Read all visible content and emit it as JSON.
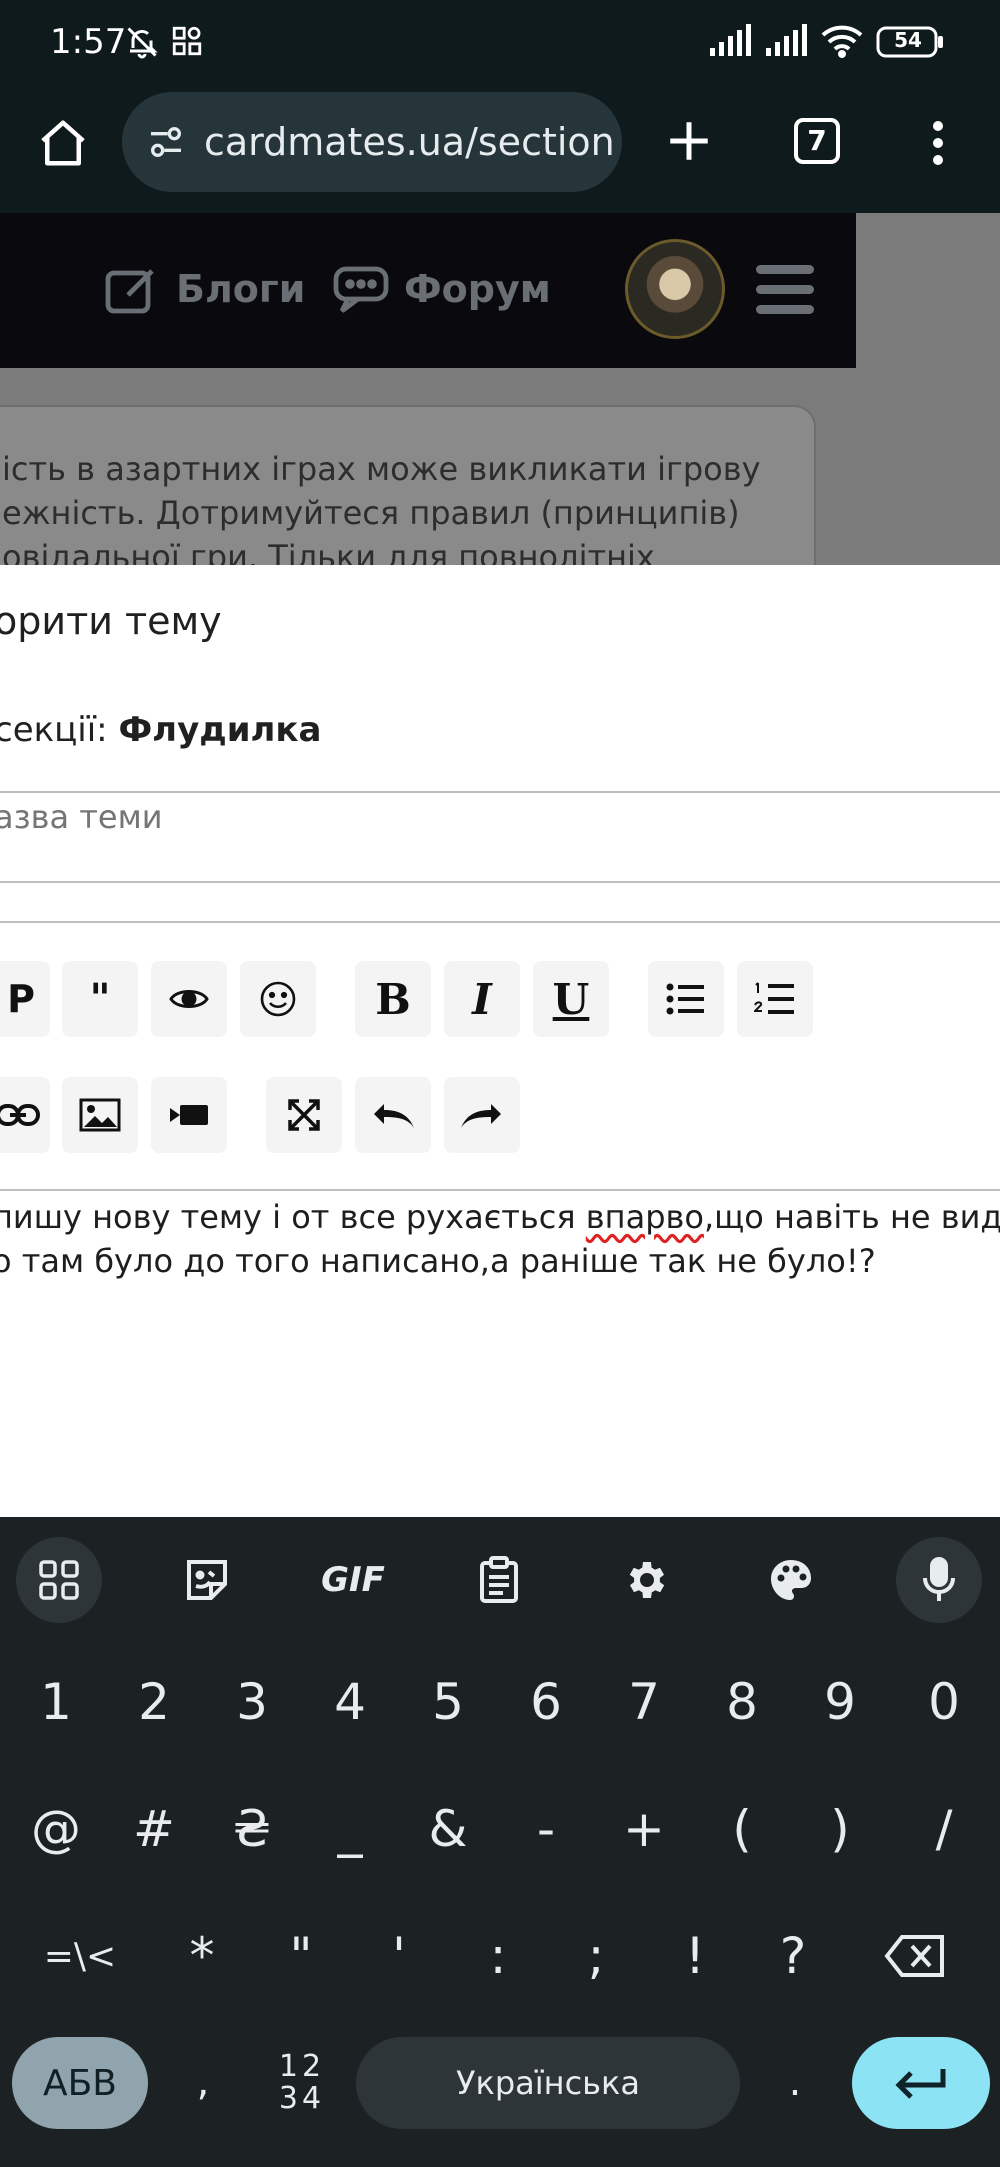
{
  "status_bar": {
    "time": "1:57",
    "battery": "54"
  },
  "browser": {
    "url": "cardmates.ua/section",
    "tab_count": "7"
  },
  "site_nav": {
    "blogs": "Блоги",
    "forum": "Форум"
  },
  "warning": {
    "text": "ість в азартних іграх може викликати ігрову ежність. Дотримуйтеся правил (принципів) овідальної гри. Тільки для повнолітніх"
  },
  "modal": {
    "title": "орити тему",
    "section_prefix": "секції: ",
    "section_name": "Флудилка",
    "topic_placeholder": "азва теми",
    "toolbar_row1": [
      "P",
      "\"",
      "eye",
      "smile",
      "B",
      "I",
      "U",
      "bullet-list",
      "numbered-list"
    ],
    "editor_line1_a": " пишу нову тему і от все рухається ",
    "editor_line1_misspelled": "впарво",
    "editor_line1_b": ",що навіть не видно",
    "editor_line2": "о там було до того написано,а раніше так не було!?"
  },
  "keyboard": {
    "toolbar": [
      "apps-icon",
      "sticker-icon",
      "GIF",
      "clipboard-icon",
      "settings-icon",
      "palette-icon",
      "mic-icon"
    ],
    "gif_label": "GIF",
    "row1": [
      "1",
      "2",
      "3",
      "4",
      "5",
      "6",
      "7",
      "8",
      "9",
      "0"
    ],
    "row2": [
      "@",
      "#",
      "₴",
      "_",
      "&",
      "-",
      "+",
      "(",
      ")",
      "/"
    ],
    "row3": [
      "=\\<",
      "*",
      "\"",
      "'",
      ":",
      ";",
      "!",
      "?"
    ],
    "abc_label": "АБВ",
    "comma": ",",
    "num_label_top": "12",
    "num_label_bottom": "34",
    "space_label": "Українська",
    "period": "."
  }
}
